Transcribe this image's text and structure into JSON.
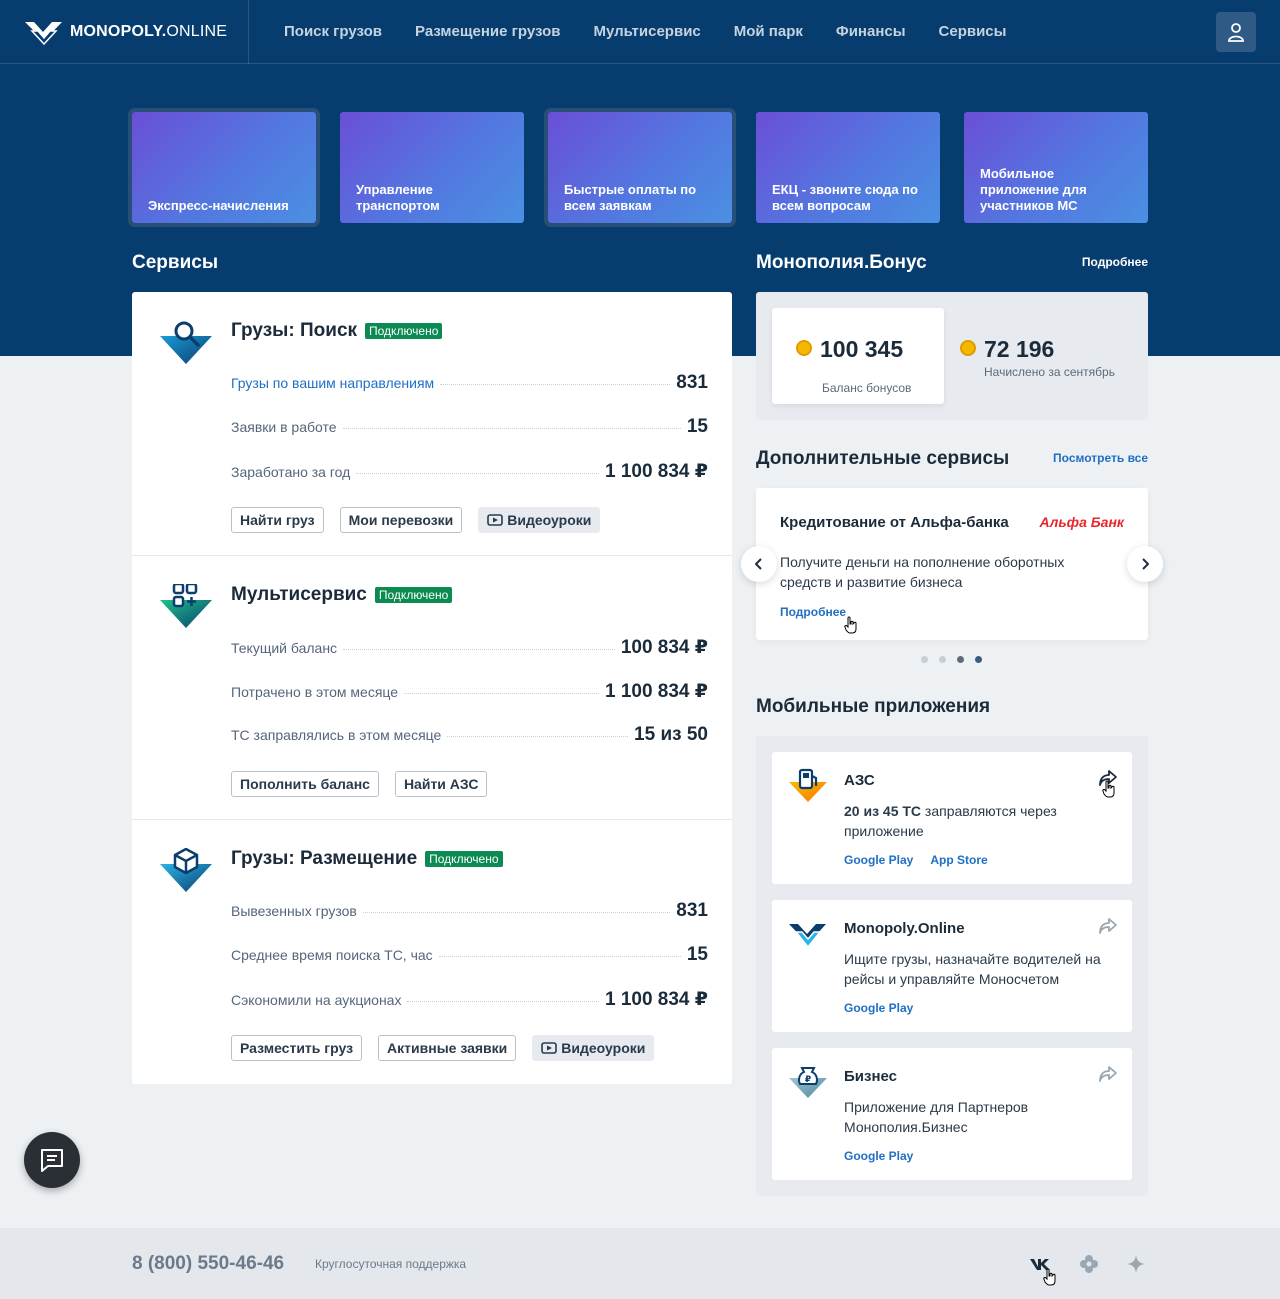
{
  "header": {
    "logo_text_bold": "MONOPOLY.",
    "logo_text_light": "ONLINE",
    "nav": [
      "Поиск грузов",
      "Размещение грузов",
      "Мультисервис",
      "Мой парк",
      "Финансы",
      "Сервисы"
    ]
  },
  "tiles": [
    {
      "label": "Экспресс-начисления",
      "selected": true
    },
    {
      "label": "Управление транспортом",
      "selected": false
    },
    {
      "label": "Быстрые оплаты по всем заявкам",
      "selected": true
    },
    {
      "label": "ЕКЦ - звоните сюда по всем вопросам",
      "selected": false
    },
    {
      "label": "Мобильное приложение для участников МС",
      "selected": false
    }
  ],
  "services_title": "Сервисы",
  "services": [
    {
      "name": "Грузы: Поиск",
      "badge": "Подключено",
      "rows": [
        {
          "label": "Грузы по вашим направлениям",
          "value": "831",
          "link": true
        },
        {
          "label": "Заявки в работе",
          "value": "15"
        },
        {
          "label": "Заработано за год",
          "value": "1 100 834 ₽"
        }
      ],
      "buttons": [
        "Найти груз",
        "Мои перевозки",
        "Видеоуроки"
      ]
    },
    {
      "name": "Мультисервис",
      "badge": "Подключено",
      "rows": [
        {
          "label": "Текущий баланс",
          "value": "100 834 ₽"
        },
        {
          "label": "Потрачено в этом месяце",
          "value": "1 100 834 ₽"
        },
        {
          "label": "ТС заправлялись в этом месяце",
          "value": "15 из 50"
        }
      ],
      "buttons": [
        "Пополнить баланс",
        "Найти АЗС"
      ]
    },
    {
      "name": "Грузы: Размещение",
      "badge": "Подключено",
      "rows": [
        {
          "label": "Вывезенных грузов",
          "value": "831"
        },
        {
          "label": "Среднее время поиска ТС, час",
          "value": "15"
        },
        {
          "label": "Сэкономили на аукционах",
          "value": "1 100 834 ₽"
        }
      ],
      "buttons": [
        "Разместить груз",
        "Активные заявки",
        "Видеоуроки"
      ]
    }
  ],
  "bonus": {
    "title": "Монополия.Бонус",
    "more": "Подробнее",
    "balance": "100 345",
    "balance_label": "Баланс бонусов",
    "accrued": "72 196",
    "accrued_label": "Начислено за сентябрь"
  },
  "extra": {
    "title": "Дополнительные сервисы",
    "see_all": "Посмотреть все",
    "offer_title": "Кредитование от Альфа-банка",
    "offer_brand": "Альфа Банк",
    "offer_text": "Получите деньги на пополнение оборотных средств и развитие бизнеса",
    "offer_more": "Подробнее",
    "active_dot": 3
  },
  "apps": {
    "title": "Мобильные приложения",
    "items": [
      {
        "name": "АЗС",
        "desc_bold": "20 из 45 ТС",
        "desc": " заправляются через приложение",
        "links": [
          "Google Play",
          "App Store"
        ]
      },
      {
        "name": "Monopoly.Online",
        "desc_bold": "",
        "desc": "Ищите грузы, назначайте водителей на рейсы и управляйте Моносчетом",
        "links": [
          "Google Play"
        ]
      },
      {
        "name": "Бизнес",
        "desc_bold": "",
        "desc": "Приложение для Партнеров Монополия.Бизнес",
        "links": [
          "Google Play"
        ]
      }
    ]
  },
  "footer": {
    "phone": "8 (800) 550-46-46",
    "phone_label": "Круглосуточная поддержка"
  },
  "colors": {
    "navy": "#063c6e",
    "green_badge": "#0b8a52",
    "link_blue": "#1f6fc4",
    "alfa_red": "#e8262c"
  }
}
